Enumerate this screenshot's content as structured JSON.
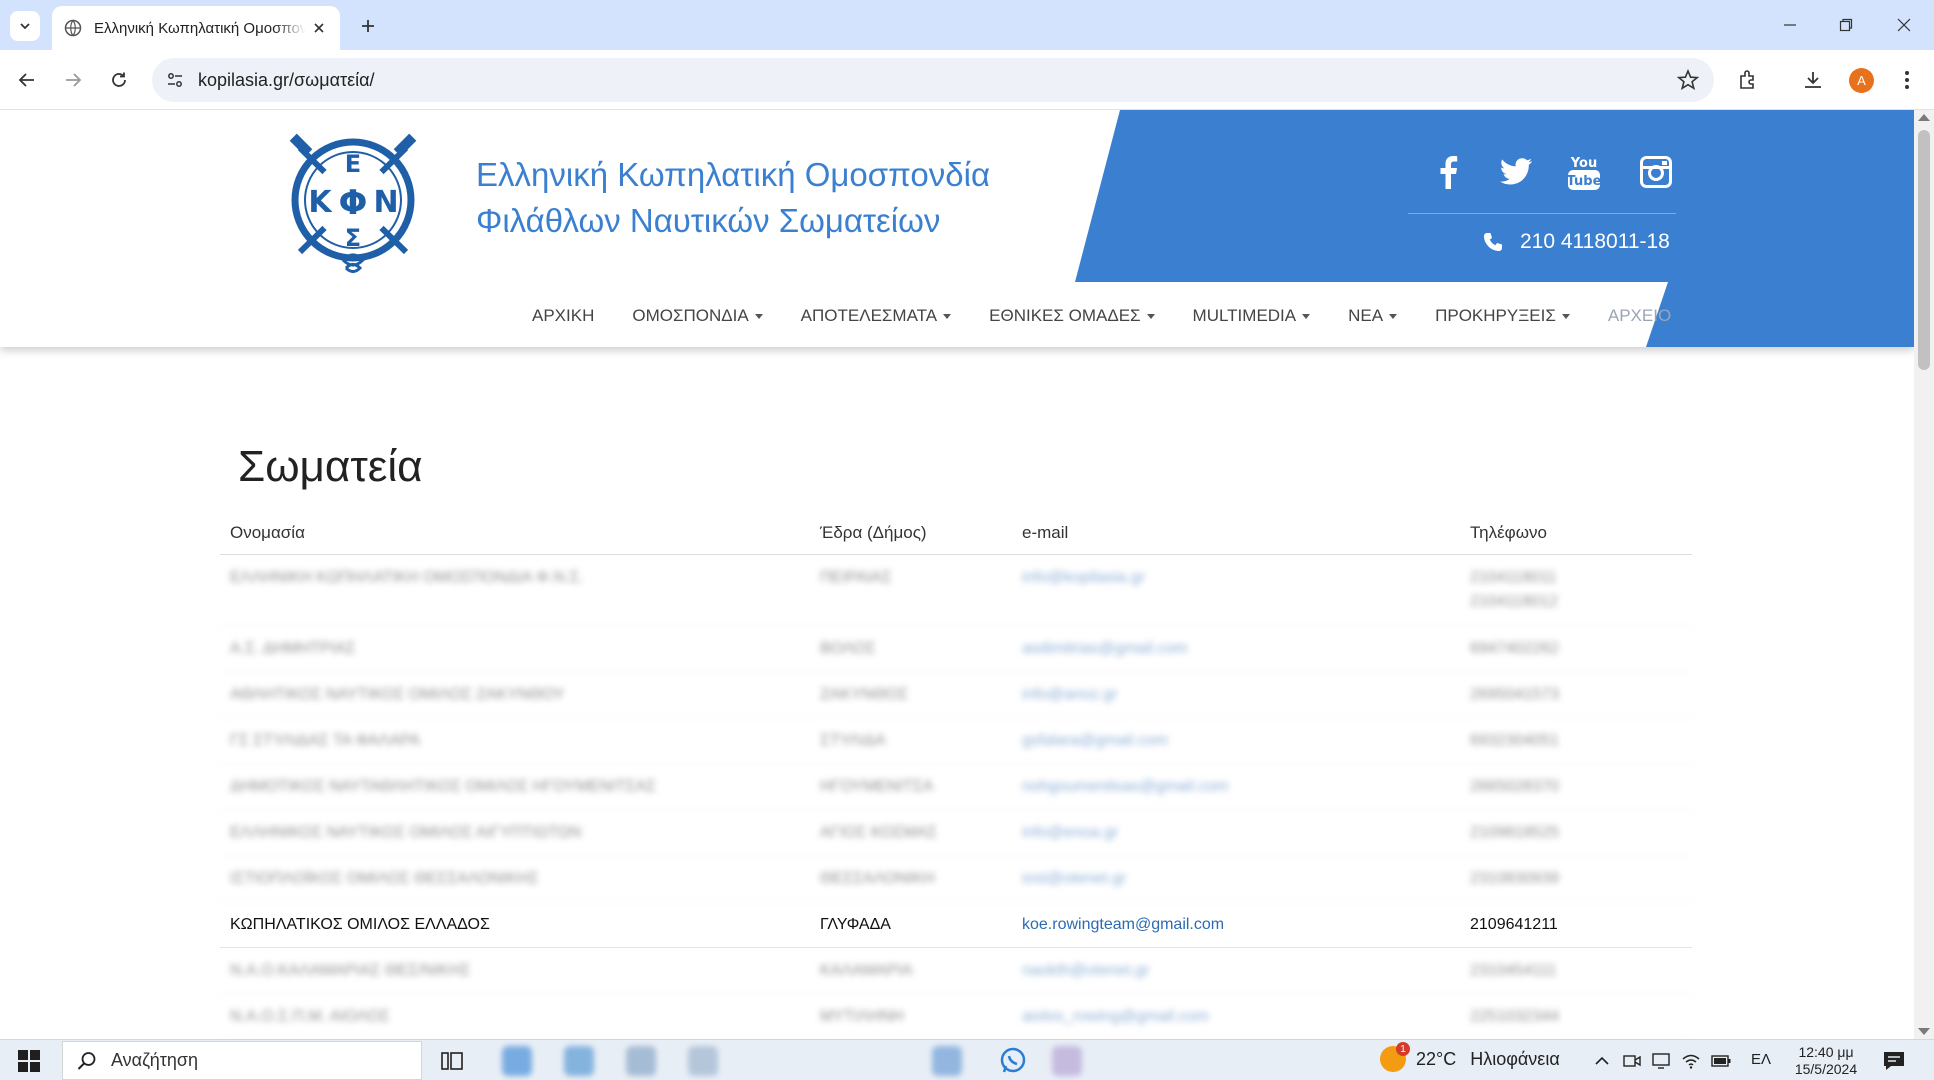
{
  "browser": {
    "tab_title": "Ελληνική Κωπηλατική Ομοσπονδία",
    "url": "kopilasia.gr/σωματεία/",
    "profile_initial": "A"
  },
  "site": {
    "brand_line1": "Ελληνική Κωπηλατική Ομοσπονδία",
    "brand_line2": "Φιλάθλων Ναυτικών Σωματείων",
    "phone": "210 4118011-18",
    "logo_letters": [
      "Ε",
      "Κ",
      "Φ",
      "Ν",
      "Σ"
    ],
    "social": [
      "facebook-icon",
      "twitter-icon",
      "youtube-icon",
      "instagram-icon"
    ],
    "nav": [
      {
        "label": "ΑΡΧΙΚΗ",
        "dropdown": false
      },
      {
        "label": "ΟΜΟΣΠΟΝΔΙΑ",
        "dropdown": true
      },
      {
        "label": "ΑΠΟΤΕΛΕΣΜΑΤΑ",
        "dropdown": true
      },
      {
        "label": "ΕΘΝΙΚΕΣ ΟΜΑΔΕΣ",
        "dropdown": true
      },
      {
        "label": "MULTIMEDIA",
        "dropdown": true
      },
      {
        "label": "ΝΕΑ",
        "dropdown": true
      },
      {
        "label": "ΠΡΟΚΗΡΥΞΕΙΣ",
        "dropdown": true
      },
      {
        "label": "ΑΡΧΕΙΟ",
        "dropdown": false
      }
    ],
    "colors": {
      "brand_blue": "#3b80d0"
    }
  },
  "page": {
    "title": "Σωματεία",
    "table": {
      "headers": [
        "Ονομασία",
        "Έδρα (Δήμος)",
        "e-mail",
        "Τηλέφωνο"
      ],
      "rows": [
        {
          "name": "ΕΛΛΗΝΙΚΗ ΚΩΠΗΛΑΤΙΚΗ ΟΜΟΣΠΟΝΔΙΑ Φ.Ν.Σ.",
          "city": "ΠΕΙΡΑΙΑΣ",
          "email": "info@kopilasia.gr",
          "phone": "2104118011",
          "phone2": "2104118012",
          "blurred": true
        },
        {
          "name": "Α.Σ. ΔΗΜΗΤΡΙΑΣ",
          "city": "ΒΟΛΟΣ",
          "email": "asdimitrias@gmail.com",
          "phone": "6947402262",
          "blurred": true
        },
        {
          "name": "ΑΘΛΗΤΙΚΟΣ ΝΑΥΤΙΚΟΣ ΟΜΙΛΟΣ ΖΑΚΥΝΘΟΥ",
          "city": "ΖΑΚΥΝΘΟΣ",
          "email": "info@anoz.gr",
          "phone": "2695041573",
          "blurred": true
        },
        {
          "name": "ΓΣ ΣΤΥΛΙΔΑΣ ΤΑ ΦΑΛΑΡΑ",
          "city": "ΣΤΥΛΙΔΑ",
          "email": "gsfalara@gmail.com",
          "phone": "6932304051",
          "blurred": true
        },
        {
          "name": "ΔΗΜΟΤΙΚΟΣ ΝΑΥΤΑΘΛΗΤΙΚΟΣ ΟΜΙΛΟΣ ΗΓΟΥΜΕΝΙΤΣΑΣ",
          "city": "ΗΓΟΥΜΕΝΙΤΣΑ",
          "email": "nohgoumenitsas@gmail.com",
          "phone": "2665028370",
          "blurred": true
        },
        {
          "name": "ΕΛΛΗΝΙΚΟΣ ΝΑΥΤΙΚΟΣ ΟΜΙΛΟΣ ΑΙΓΥΠΤΙΩΤΩΝ",
          "city": "ΑΓΙΟΣ ΚΟΣΜΑΣ",
          "email": "info@enoa.gr",
          "phone": "2109818525",
          "blurred": true
        },
        {
          "name": "ΙΣΤΙΟΠΛΟΪΚΟΣ ΟΜΙΛΟΣ ΘΕΣΣΑΛΟΝΙΚΗΣ",
          "city": "ΘΕΣΣΑΛΟΝΙΚΗ",
          "email": "iost@otenet.gr",
          "phone": "2310830939",
          "blurred": true
        },
        {
          "name": "ΚΩΠΗΛΑΤΙΚΟΣ ΟΜΙΛΟΣ ΕΛΛΑΔΟΣ",
          "city": "ΓΛΥΦΑΔΑ",
          "email": "koe.rowingteam@gmail.com",
          "phone": "2109641211",
          "blurred": false
        },
        {
          "name": "Ν.Α.Ο.ΚΑΛΑΜΑΡΙΑΣ ΘΕΣ/ΝΙΚΗΣ",
          "city": "ΚΑΛΑΜΑΡΙΑ",
          "email": "naokth@otenet.gr",
          "phone": "2310454111",
          "blurred": true
        },
        {
          "name": "Ν.Α.Ο.Σ.Π.Μ. ΑΙΟΛΟΣ",
          "city": "ΜΥΤΙΛΗΝΗ",
          "email": "aiolos_rowing@gmail.com",
          "phone": "2251032344",
          "blurred": true
        }
      ]
    }
  },
  "taskbar": {
    "search_placeholder": "Αναζήτηση",
    "weather_temp": "22°C",
    "weather_desc": "Ηλιοφάνεια",
    "weather_badge": "1",
    "language": "ΕΛ",
    "time": "12:40 μμ",
    "date": "15/5/2024"
  }
}
